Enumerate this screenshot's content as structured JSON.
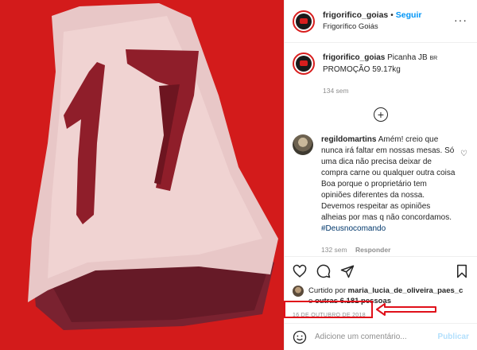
{
  "post": {
    "username": "frigorifico_goias",
    "follow_label": "Seguir",
    "location": "Frigorífico Goiás",
    "caption_text": "Picanha JB",
    "caption_tail": "PROMOÇÃO 59.17kg",
    "caption_age": "134 sem",
    "date": "16 DE OUTUBRO DE 2018",
    "image_number": "17"
  },
  "comment": {
    "username": "regildomartins",
    "text": "Amém! creio que nunca irá faltar em nossas mesas. Só uma dica não precisa deixar de compra carne ou qualquer outra coisa Boa porque o proprietário tem opiniões diferentes da nossa. Devemos respeitar as opiniões alheias por mas q não concordamos.",
    "hashtag": "#Deusnocomando",
    "age": "132 sem",
    "reply_label": "Responder"
  },
  "likes": {
    "prefix": "Curtido por",
    "user": "maria_lucia_de_oliveira_paes_c",
    "connector": "e",
    "others": "outras 6.181 pessoas"
  },
  "composer": {
    "placeholder": "Adicione um comentário...",
    "publish_label": "Publicar"
  },
  "colors": {
    "background": "#d81e1e",
    "link": "#0095f6",
    "annotation": "#e0101a"
  },
  "icons": [
    "more-icon",
    "plus-circle-icon",
    "heart-icon",
    "comment-icon",
    "share-icon",
    "bookmark-icon",
    "smile-icon"
  ]
}
